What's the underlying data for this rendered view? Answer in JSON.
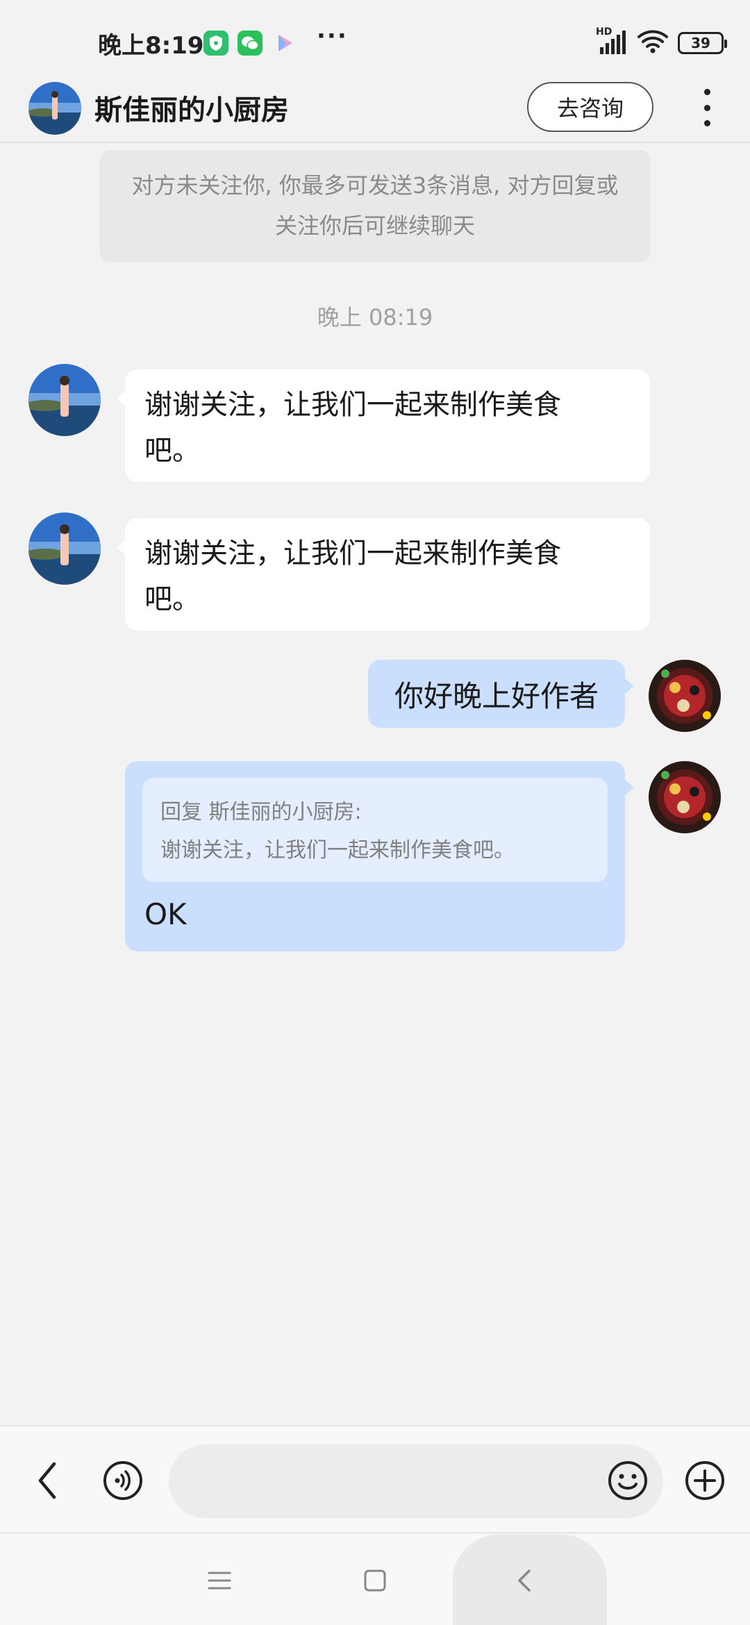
{
  "status_bar": {
    "time": "晚上8:19",
    "more": "···",
    "network": "HD",
    "battery": "39"
  },
  "header": {
    "title": "斯佳丽的小厨房",
    "consult_label": "去咨询"
  },
  "chat": {
    "notice": "对方未关注你, 你最多可发送3条消息, 对方回复或关注你后可继续聊天",
    "timestamp": "晚上 08:19",
    "messages": [
      {
        "from": "other",
        "line1": "谢谢关注，让我们一起来制作美食",
        "line2": "吧。"
      },
      {
        "from": "other",
        "line1": "谢谢关注，让我们一起来制作美食",
        "line2": "吧。"
      },
      {
        "from": "me",
        "text": "你好晚上好作者"
      },
      {
        "from": "me",
        "quote_header": "回复 斯佳丽的小厨房:",
        "quote_text": "谢谢关注，让我们一起来制作美食吧。",
        "text": "OK"
      }
    ]
  },
  "input_bar": {
    "placeholder": ""
  },
  "colors": {
    "background": "#f2f2f3",
    "outgoing_bubble": "#c9dffd",
    "incoming_bubble": "#ffffff",
    "quote_bg": "#e4eefe"
  },
  "icons": [
    "back-arrow-icon",
    "voice-icon",
    "emoji-icon",
    "plus-icon",
    "more-vertical-icon",
    "wifi-icon",
    "signal-icon",
    "battery-icon"
  ]
}
